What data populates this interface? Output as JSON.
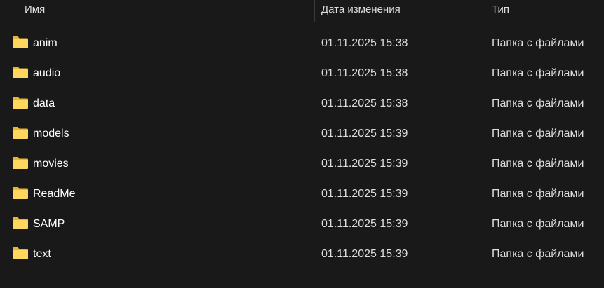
{
  "header": {
    "name": "Имя",
    "date": "Дата изменения",
    "type": "Тип"
  },
  "rows": [
    {
      "name": "anim",
      "date": "01.11.2025 15:38",
      "type": "Папка с файлами",
      "icon": "folder-icon"
    },
    {
      "name": "audio",
      "date": "01.11.2025 15:38",
      "type": "Папка с файлами",
      "icon": "folder-icon"
    },
    {
      "name": "data",
      "date": "01.11.2025 15:38",
      "type": "Папка с файлами",
      "icon": "folder-icon"
    },
    {
      "name": "models",
      "date": "01.11.2025 15:39",
      "type": "Папка с файлами",
      "icon": "folder-icon"
    },
    {
      "name": "movies",
      "date": "01.11.2025 15:39",
      "type": "Папка с файлами",
      "icon": "folder-icon"
    },
    {
      "name": "ReadMe",
      "date": "01.11.2025 15:39",
      "type": "Папка с файлами",
      "icon": "folder-icon"
    },
    {
      "name": "SAMP",
      "date": "01.11.2025 15:39",
      "type": "Папка с файлами",
      "icon": "folder-icon"
    },
    {
      "name": "text",
      "date": "01.11.2025 15:39",
      "type": "Папка с файлами",
      "icon": "folder-icon"
    }
  ],
  "colors": {
    "background": "#191919",
    "folder_front": "#ffd75e",
    "folder_back": "#e8b632"
  }
}
